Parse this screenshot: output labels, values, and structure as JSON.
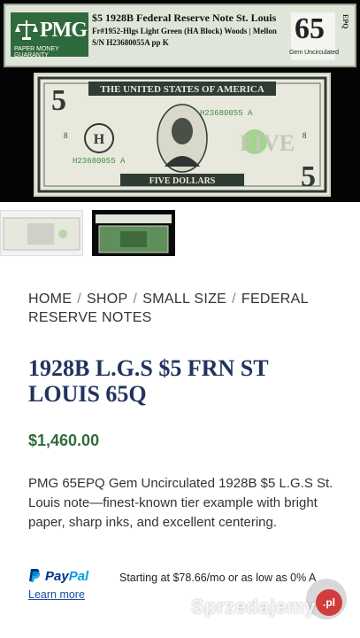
{
  "slab": {
    "logo_text": "PMG",
    "logo_tagline": "PAPER MONEY GUARANTY",
    "line1": "$5 1928B  Federal Reserve Note St. Louis",
    "line2": "Fr#1952-Hlgs Light Green (HA Block)  Woods | Mellon",
    "line3": "S/N H23680055A pp K",
    "grade": "65",
    "grade_suffix": "EPQ",
    "grade_label": "Gem Uncirculated"
  },
  "note": {
    "header": "THE UNITED STATES OF AMERICA",
    "serial_top": "H23680055 A",
    "serial_bottom": "H23680055 A",
    "district_letter": "H",
    "denomination_word": "FIVE",
    "bottom_text": "FIVE DOLLARS",
    "corner_value": "5",
    "plate_numbers": [
      "8",
      "8"
    ]
  },
  "breadcrumb": {
    "items": [
      "HOME",
      "SHOP",
      "SMALL SIZE",
      "FEDERAL RESERVE NOTES"
    ],
    "separator": "/"
  },
  "product": {
    "title": "1928B L.G.S $5 FRN ST LOUIS 65Q",
    "price": "$1,460.00",
    "description": "PMG 65EPQ Gem Uncirculated 1928B $5 L.G.S St. Louis note—finest-known tier example with bright paper, sharp inks, and excellent centering."
  },
  "paypal": {
    "brand_a": "Pay",
    "brand_b": "Pal",
    "text": "Starting at $78.66/mo or as low as 0% A",
    "learn_more": "Learn more"
  },
  "watermark": {
    "text": "Sprzedajemy",
    "badge": ".pl"
  },
  "colors": {
    "title": "#22335f",
    "price": "#2f6b3c",
    "pmg_green": "#2f6a3c",
    "paypal_dark": "#003087",
    "paypal_light": "#009cde"
  }
}
